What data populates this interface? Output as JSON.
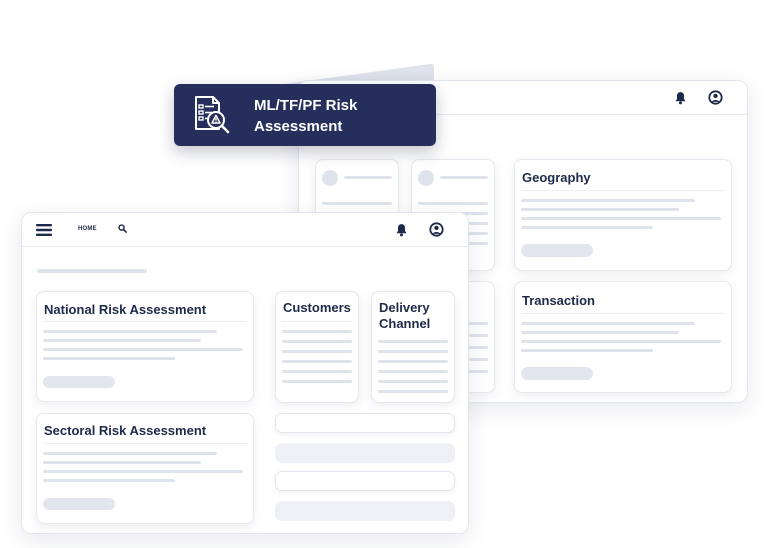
{
  "badge": {
    "title": "ML/TF/PF Risk Assessment",
    "icon": "risk-document-search-icon",
    "color": "#262f5c"
  },
  "front_window": {
    "nav": {
      "home_label": "HOME",
      "icons": [
        "menu-icon",
        "search-icon",
        "bell-icon",
        "user-icon"
      ]
    },
    "cards": {
      "national": "National Risk Assessment",
      "sectoral": "Sectoral Risk Assessment",
      "customers": "Customers",
      "delivery": "Delivery Channel"
    }
  },
  "back_window": {
    "nav": {
      "icons": [
        "bell-icon",
        "user-icon"
      ]
    },
    "cards": {
      "geography": "Geography",
      "transaction": "Transaction"
    }
  },
  "colors": {
    "navy": "#1e2a4a",
    "placeholder": "#dfe3ec",
    "border": "#e6e8ee"
  }
}
